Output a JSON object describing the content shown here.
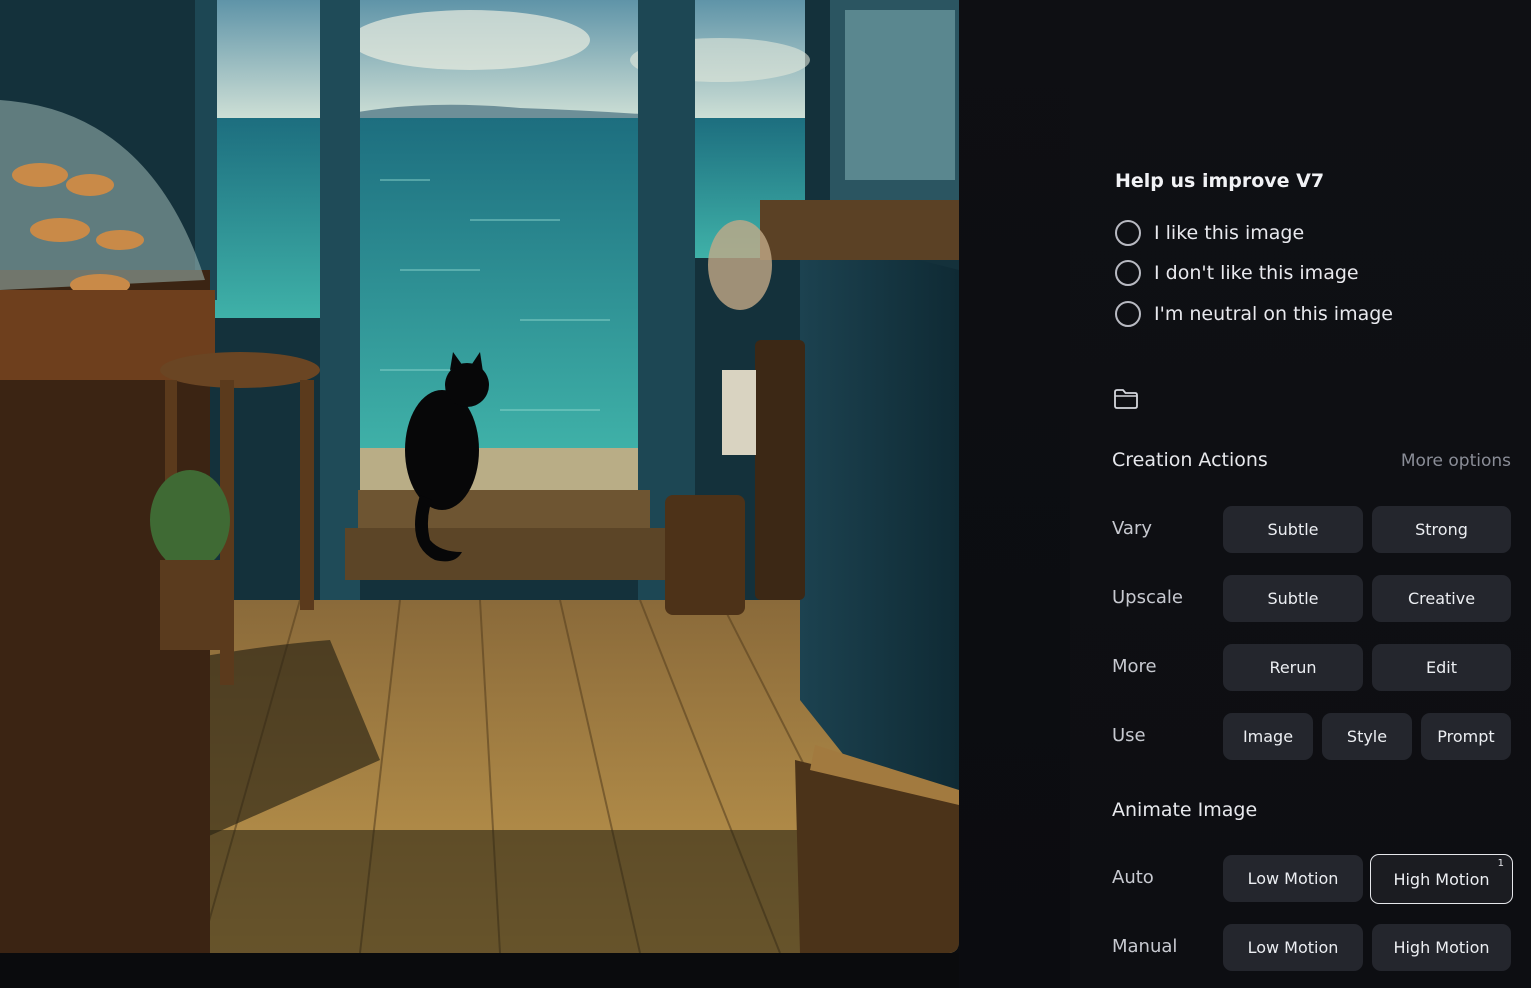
{
  "feedback": {
    "title": "Help us improve V7",
    "options": [
      "I like this image",
      "I don't like this image",
      "I'm neutral on this image"
    ]
  },
  "creation_actions": {
    "title": "Creation Actions",
    "more_options": "More options",
    "rows": [
      {
        "label": "Vary",
        "buttons": [
          "Subtle",
          "Strong"
        ]
      },
      {
        "label": "Upscale",
        "buttons": [
          "Subtle",
          "Creative"
        ]
      },
      {
        "label": "More",
        "buttons": [
          "Rerun",
          "Edit"
        ]
      },
      {
        "label": "Use",
        "buttons": [
          "Image",
          "Style",
          "Prompt"
        ]
      }
    ]
  },
  "animate": {
    "title": "Animate Image",
    "rows": [
      {
        "label": "Auto",
        "buttons": [
          "Low Motion",
          "High Motion"
        ],
        "selected": "High Motion",
        "badge": "1"
      },
      {
        "label": "Manual",
        "buttons": [
          "Low Motion",
          "High Motion"
        ]
      }
    ]
  },
  "icons": {
    "folder": "folder-icon"
  },
  "colors": {
    "button_bg": "#24262d",
    "panel_bg": "#0f1014",
    "selected_border": "#e6e7eb"
  }
}
